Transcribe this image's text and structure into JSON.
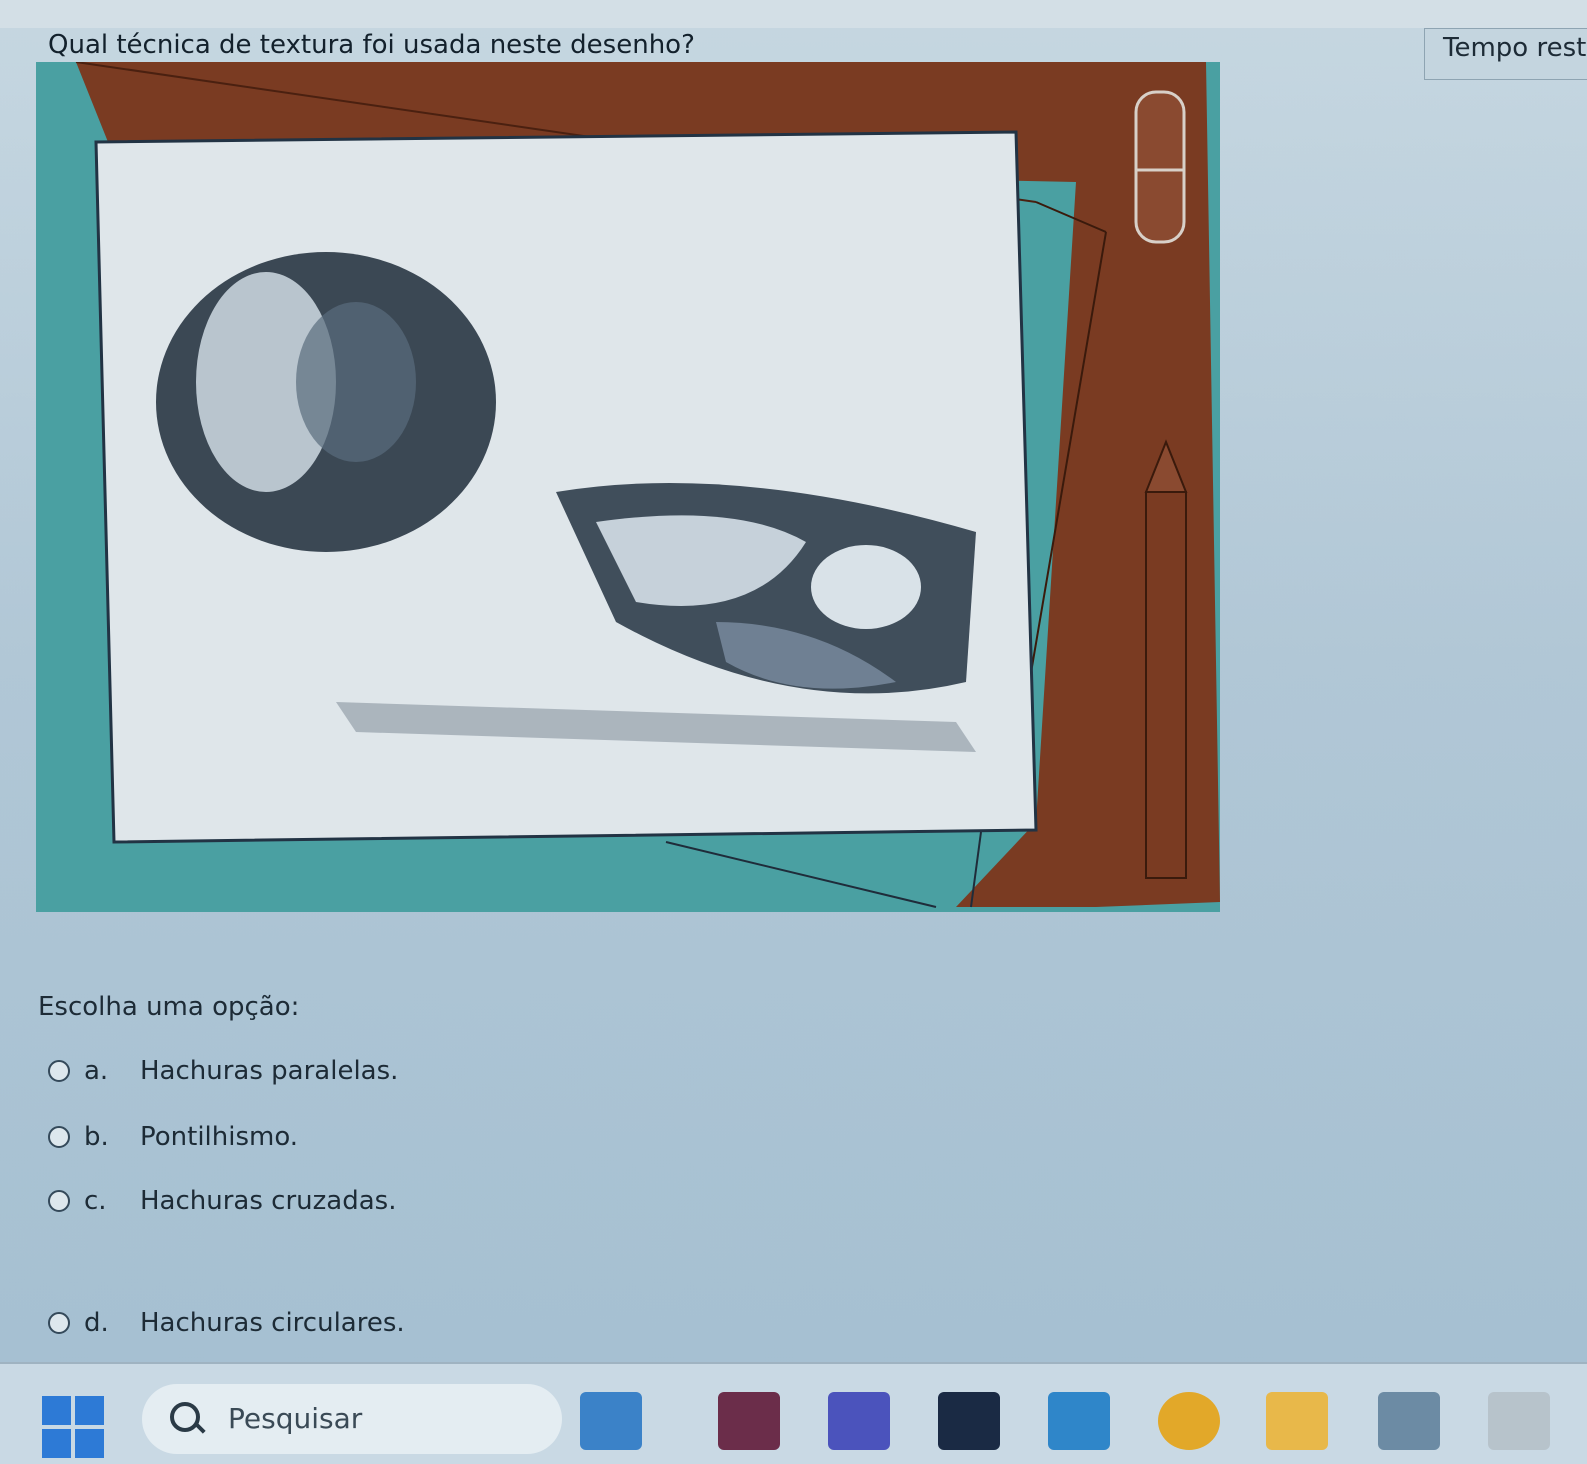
{
  "quiz": {
    "question": "Qual técnica de textura foi usada neste desenho?",
    "timer_label": "Tempo rest",
    "prompt": "Escolha uma opção:",
    "options": [
      {
        "letter": "a.",
        "text": "Hachuras paralelas."
      },
      {
        "letter": "b.",
        "text": "Pontilhismo."
      },
      {
        "letter": "c.",
        "text": "Hachuras cruzadas."
      },
      {
        "letter": "d.",
        "text": "Hachuras circulares."
      }
    ]
  },
  "taskbar": {
    "search_placeholder": "Pesquisar",
    "apps": [
      "photos-icon",
      "winrar-icon",
      "teams-icon",
      "disney-plus-icon",
      "store-icon",
      "chrome-icon",
      "file-explorer-icon",
      "prime-video-icon",
      "printer-icon"
    ],
    "accent": "#2d7ad6"
  },
  "colors": {
    "wood": "#7a3b22",
    "teal": "#4aa0a2",
    "paper": "#dfe6ea"
  }
}
